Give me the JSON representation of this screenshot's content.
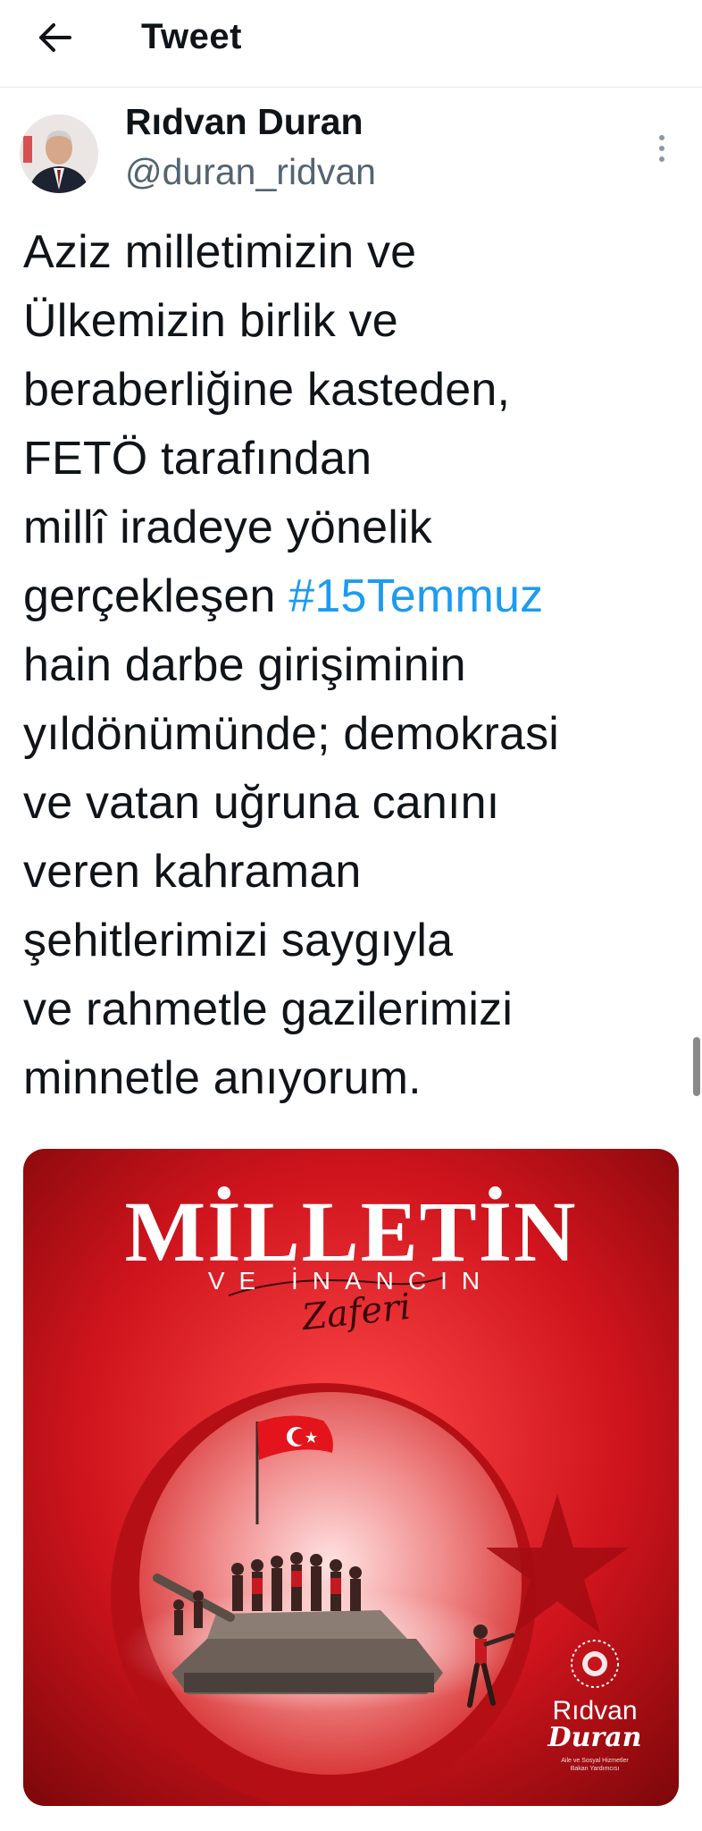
{
  "header": {
    "title": "Tweet",
    "back_icon": "arrow-left-icon"
  },
  "author": {
    "name": "Rıdvan Duran",
    "handle": "@duran_ridvan",
    "more_icon": "more-vertical-icon"
  },
  "tweet": {
    "lines": [
      "Aziz milletimizin ve",
      "Ülkemizin birlik ve",
      "beraberliğine kasteden,",
      "FETÖ tarafından",
      "millî iradeye yönelik"
    ],
    "line6_prefix": "gerçekleşen ",
    "hashtag": "#15Temmuz",
    "lines_after": [
      "hain darbe girişiminin",
      "yıldönümünde; demokrasi",
      "ve vatan uğruna canını",
      "veren kahraman",
      "şehitlerimizi saygıyla",
      "ve rahmetle gazilerimizi",
      "minnetle anıyorum."
    ],
    "hashtag_color": "#1d9bf0"
  },
  "media": {
    "title": "MİLLETİN",
    "subtitle": "VE İNANCIN",
    "script": "Zaferi",
    "brand_name": "Rıdvan",
    "brand_surname": "Duran",
    "brand_caption_1": "Aile ve Sosyal Hizmetler",
    "brand_caption_2": "Bakan Yardımcısı",
    "background_color": "#c8141c"
  }
}
